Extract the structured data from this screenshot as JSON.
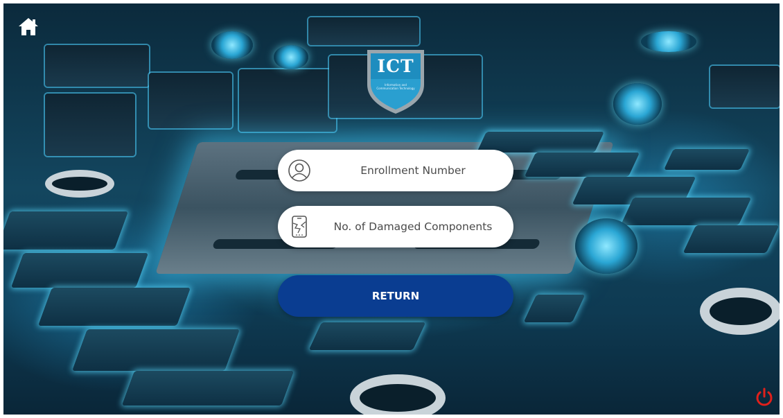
{
  "nav": {
    "home_icon": "home-icon",
    "power_icon": "power-icon"
  },
  "logo": {
    "title": "ICT",
    "subtitle": "Information and Communication Technology"
  },
  "form": {
    "enrollment": {
      "label": "Enrollment Number",
      "icon": "user-icon"
    },
    "damaged": {
      "label": "No. of Damaged Components",
      "icon": "broken-phone-icon"
    },
    "return_label": "RETURN"
  },
  "colors": {
    "primary_button": "#0a3d91",
    "power": "#e0201b",
    "logo_shield": "#2a9fd0"
  }
}
